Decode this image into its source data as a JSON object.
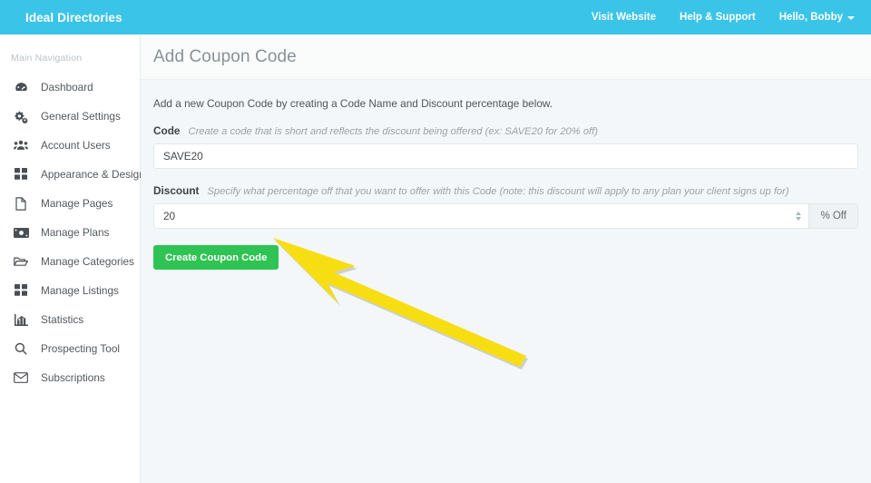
{
  "header": {
    "brand": "Ideal Directories",
    "nav": [
      {
        "label": "Visit Website",
        "name": "visit-website"
      },
      {
        "label": "Help & Support",
        "name": "help-support"
      },
      {
        "label": "Hello, Bobby",
        "name": "user-menu",
        "caret": true
      }
    ],
    "background_color": "#3ac4e8"
  },
  "sidebar": {
    "heading": "Main Navigation",
    "items": [
      {
        "label": "Dashboard",
        "icon": "speedometer-icon"
      },
      {
        "label": "General Settings",
        "icon": "gears-icon"
      },
      {
        "label": "Account Users",
        "icon": "users-icon"
      },
      {
        "label": "Appearance & Design",
        "icon": "grid-icon"
      },
      {
        "label": "Manage Pages",
        "icon": "file-icon"
      },
      {
        "label": "Manage Plans",
        "icon": "money-bill-icon"
      },
      {
        "label": "Manage Categories",
        "icon": "folder-open-icon"
      },
      {
        "label": "Manage Listings",
        "icon": "grid-icon"
      },
      {
        "label": "Statistics",
        "icon": "bar-chart-icon"
      },
      {
        "label": "Prospecting Tool",
        "icon": "search-icon"
      },
      {
        "label": "Subscriptions",
        "icon": "envelope-icon"
      }
    ]
  },
  "main": {
    "page_title": "Add Coupon Code",
    "intro": "Add a new Coupon Code by creating a Code Name and Discount percentage below.",
    "fields": {
      "code": {
        "label": "Code",
        "hint": "Create a code that is short and reflects the discount being offered (ex: SAVE20 for 20% off)",
        "value": "SAVE20",
        "placeholder": ""
      },
      "discount": {
        "label": "Discount",
        "hint": "Specify what percentage off that you want to offer with this Code (note: this discount will apply to any plan your client signs up for)",
        "value": "20",
        "placeholder": "",
        "addon": "% Off"
      }
    },
    "submit_label": "Create Coupon Code",
    "submit_color": "#2fc354"
  },
  "annotation": {
    "arrow_color": "#f7de12",
    "description": "yellow arrow pointing at Create Coupon Code button"
  }
}
